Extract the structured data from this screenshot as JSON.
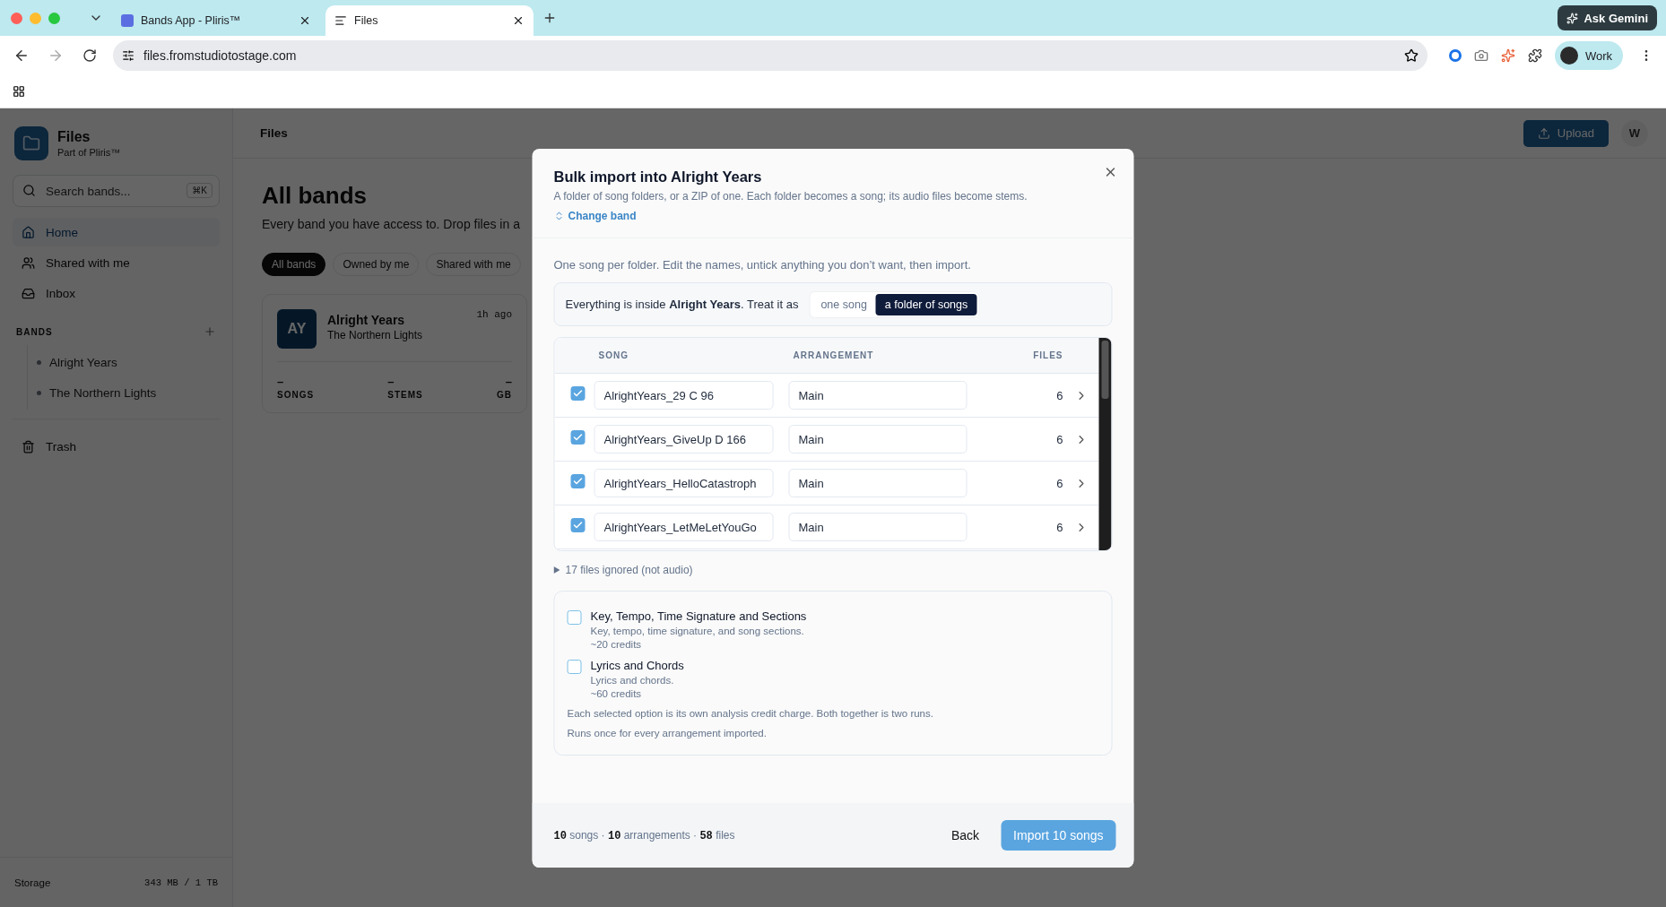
{
  "browser": {
    "tabs": [
      {
        "title": "Bands App - Pliris™",
        "selected": false
      },
      {
        "title": "Files",
        "selected": true
      }
    ],
    "ask_button": "Ask Gemini",
    "url": "files.fromstudiotostage.com",
    "profile": "Work"
  },
  "sidebar": {
    "app_title": "Files",
    "app_subtitle": "Part of Pliris™",
    "search": {
      "placeholder": "Search bands...",
      "shortcut": "⌘K"
    },
    "nav": [
      {
        "label": "Home",
        "kind": "home",
        "selected": true
      },
      {
        "label": "Shared with me",
        "kind": "shared",
        "selected": false
      },
      {
        "label": "Inbox",
        "kind": "inbox",
        "selected": false
      }
    ],
    "bands_heading": "BANDS",
    "bands": [
      "Alright Years",
      "The Northern Lights"
    ],
    "trash": "Trash",
    "storage_label": "Storage",
    "storage_value": "343 MB / 1 TB"
  },
  "header": {
    "title": "Files",
    "upload": "Upload",
    "avatar": "W"
  },
  "page": {
    "title": "All bands",
    "subtitle": "Every band you have access to. Drop files in a",
    "filters": [
      {
        "label": "All bands",
        "selected": true
      },
      {
        "label": "Owned by me",
        "selected": false
      },
      {
        "label": "Shared with me",
        "selected": false
      }
    ],
    "card": {
      "initials": "AY",
      "name": "Alright Years",
      "subtitle": "The Northern Lights",
      "time": "1h ago",
      "stats": [
        {
          "value": "–",
          "label": "SONGS"
        },
        {
          "value": "–",
          "label": "STEMS"
        },
        {
          "value": "–",
          "label": "GB"
        }
      ]
    }
  },
  "modal": {
    "title": "Bulk import into Alright Years",
    "description": "A folder of song folders, or a ZIP of one. Each folder becomes a song; its audio files become stems.",
    "change_link": "Change band",
    "instruction": "One song per folder. Edit the names, untick anything you don’t want, then import.",
    "mode_text": "Everything is inside **Alright Years**. Treat it as",
    "mode_options": [
      {
        "label": "one song",
        "selected": false
      },
      {
        "label": "a folder of songs",
        "selected": true
      }
    ],
    "table": {
      "columns": [
        "SONG",
        "ARRANGEMENT",
        "FILES"
      ],
      "rows": [
        {
          "checked": true,
          "song": "AlrightYears_29 C 96",
          "arrangement": "Main",
          "files": "6"
        },
        {
          "checked": true,
          "song": "AlrightYears_GiveUp D 166",
          "arrangement": "Main",
          "files": "6"
        },
        {
          "checked": true,
          "song": "AlrightYears_HelloCatastroph",
          "arrangement": "Main",
          "files": "6"
        },
        {
          "checked": true,
          "song": "AlrightYears_LetMeLetYouGo",
          "arrangement": "Main",
          "files": "6"
        }
      ]
    },
    "ignored": "17 files ignored (not audio)",
    "options": [
      {
        "title": "Key, Tempo, Time Signature and Sections",
        "description": "Key, tempo, time signature, and song sections.",
        "cost": "~20 credits",
        "checked": false
      },
      {
        "title": "Lyrics and Chords",
        "description": "Lyrics and chords.",
        "cost": "~60 credits",
        "checked": false
      }
    ],
    "notes": [
      "Each selected option is its own analysis credit charge. Both together is two runs.",
      "Runs once for every arrangement imported."
    ],
    "summary": "**10** songs · **10** arrangements · **58** files",
    "back": "Back",
    "import": "Import 10 songs"
  }
}
